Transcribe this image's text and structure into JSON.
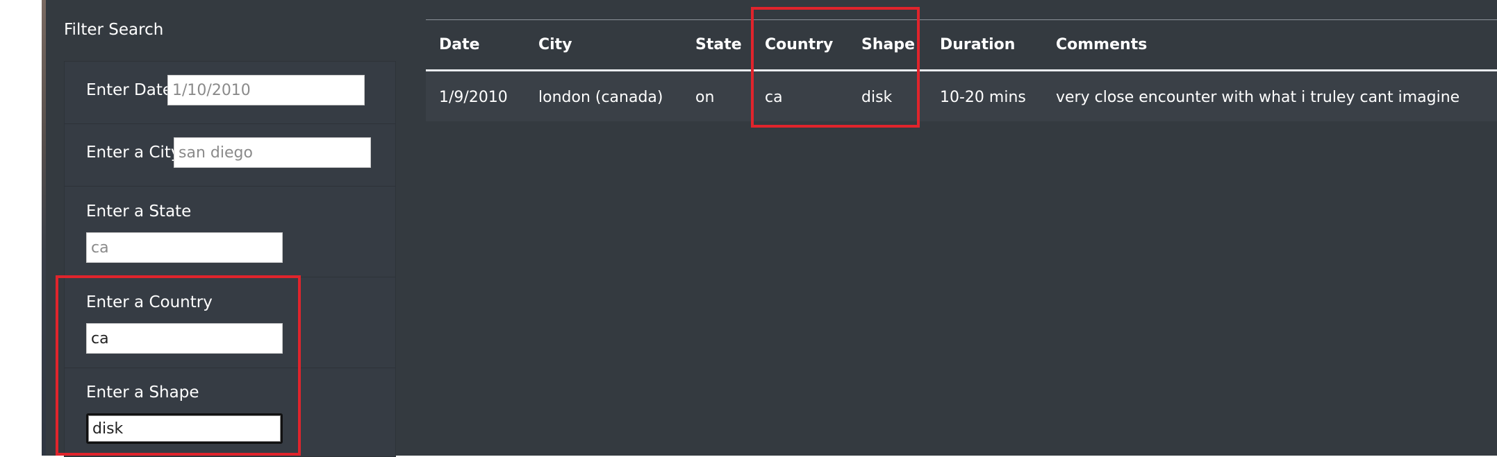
{
  "sidebar": {
    "title": "Filter Search",
    "filters": {
      "date": {
        "label": "Enter Date",
        "value": "",
        "placeholder": "1/10/2010"
      },
      "city": {
        "label": "Enter a City",
        "value": "",
        "placeholder": "san diego"
      },
      "state": {
        "label": "Enter a State",
        "value": "",
        "placeholder": "ca"
      },
      "country": {
        "label": "Enter a Country",
        "value": "ca",
        "placeholder": ""
      },
      "shape": {
        "label": "Enter a Shape",
        "value": "disk",
        "placeholder": ""
      }
    }
  },
  "table": {
    "headers": {
      "date": "Date",
      "city": "City",
      "state": "State",
      "country": "Country",
      "shape": "Shape",
      "duration": "Duration",
      "comments": "Comments"
    },
    "rows": [
      {
        "date": "1/9/2010",
        "city": "london (canada)",
        "state": "on",
        "country": "ca",
        "shape": "disk",
        "duration": "10-20 mins",
        "comments": "very close encounter with what i truley cant imagine"
      }
    ]
  },
  "colors": {
    "background": "#343a40",
    "highlight": "#e0242c",
    "text": "#ffffff"
  }
}
